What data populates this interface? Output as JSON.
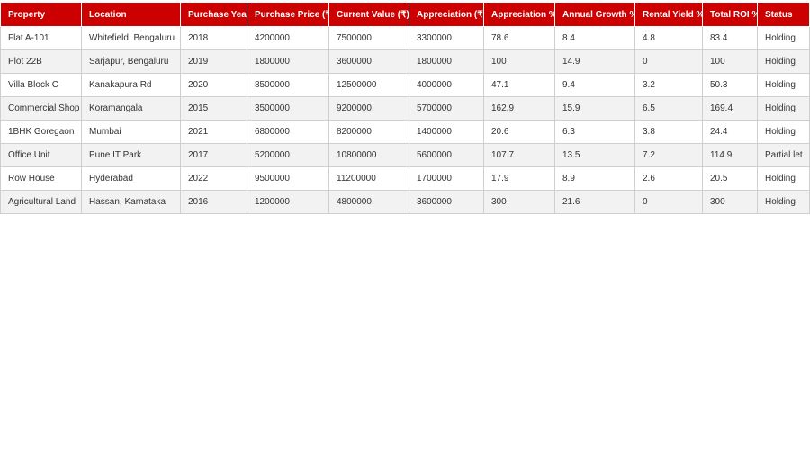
{
  "theme": {
    "header_bg": "#cc0000",
    "header_text": "#ffffff",
    "row_alt_bg": "#f2f2f2",
    "border": "#cfcfcf"
  },
  "table": {
    "columns": [
      "Property",
      "Location",
      "Purchase Year",
      "Purchase Price (₹)",
      "Current Value (₹)",
      "Appreciation (₹)",
      "Appreciation %",
      "Annual Growth %",
      "Rental Yield %",
      "Total ROI %",
      "Status"
    ],
    "rows": [
      [
        "Flat A-101",
        "Whitefield, Bengaluru",
        "2018",
        "4200000",
        "7500000",
        "3300000",
        "78.6",
        "8.4",
        "4.8",
        "83.4",
        "Holding"
      ],
      [
        "Plot 22B",
        "Sarjapur, Bengaluru",
        "2019",
        "1800000",
        "3600000",
        "1800000",
        "100",
        "14.9",
        "0",
        "100",
        "Holding"
      ],
      [
        "Villa Block C",
        "Kanakapura Rd",
        "2020",
        "8500000",
        "12500000",
        "4000000",
        "47.1",
        "9.4",
        "3.2",
        "50.3",
        "Holding"
      ],
      [
        "Commercial Shop",
        "Koramangala",
        "2015",
        "3500000",
        "9200000",
        "5700000",
        "162.9",
        "15.9",
        "6.5",
        "169.4",
        "Holding"
      ],
      [
        "1BHK Goregaon",
        "Mumbai",
        "2021",
        "6800000",
        "8200000",
        "1400000",
        "20.6",
        "6.3",
        "3.8",
        "24.4",
        "Holding"
      ],
      [
        "Office Unit",
        "Pune IT Park",
        "2017",
        "5200000",
        "10800000",
        "5600000",
        "107.7",
        "13.5",
        "7.2",
        "114.9",
        "Partial let"
      ],
      [
        "Row House",
        "Hyderabad",
        "2022",
        "9500000",
        "11200000",
        "1700000",
        "17.9",
        "8.9",
        "2.6",
        "20.5",
        "Holding"
      ],
      [
        "Agricultural Land",
        "Hassan, Karnataka",
        "2016",
        "1200000",
        "4800000",
        "3600000",
        "300",
        "21.6",
        "0",
        "300",
        "Holding"
      ]
    ]
  }
}
